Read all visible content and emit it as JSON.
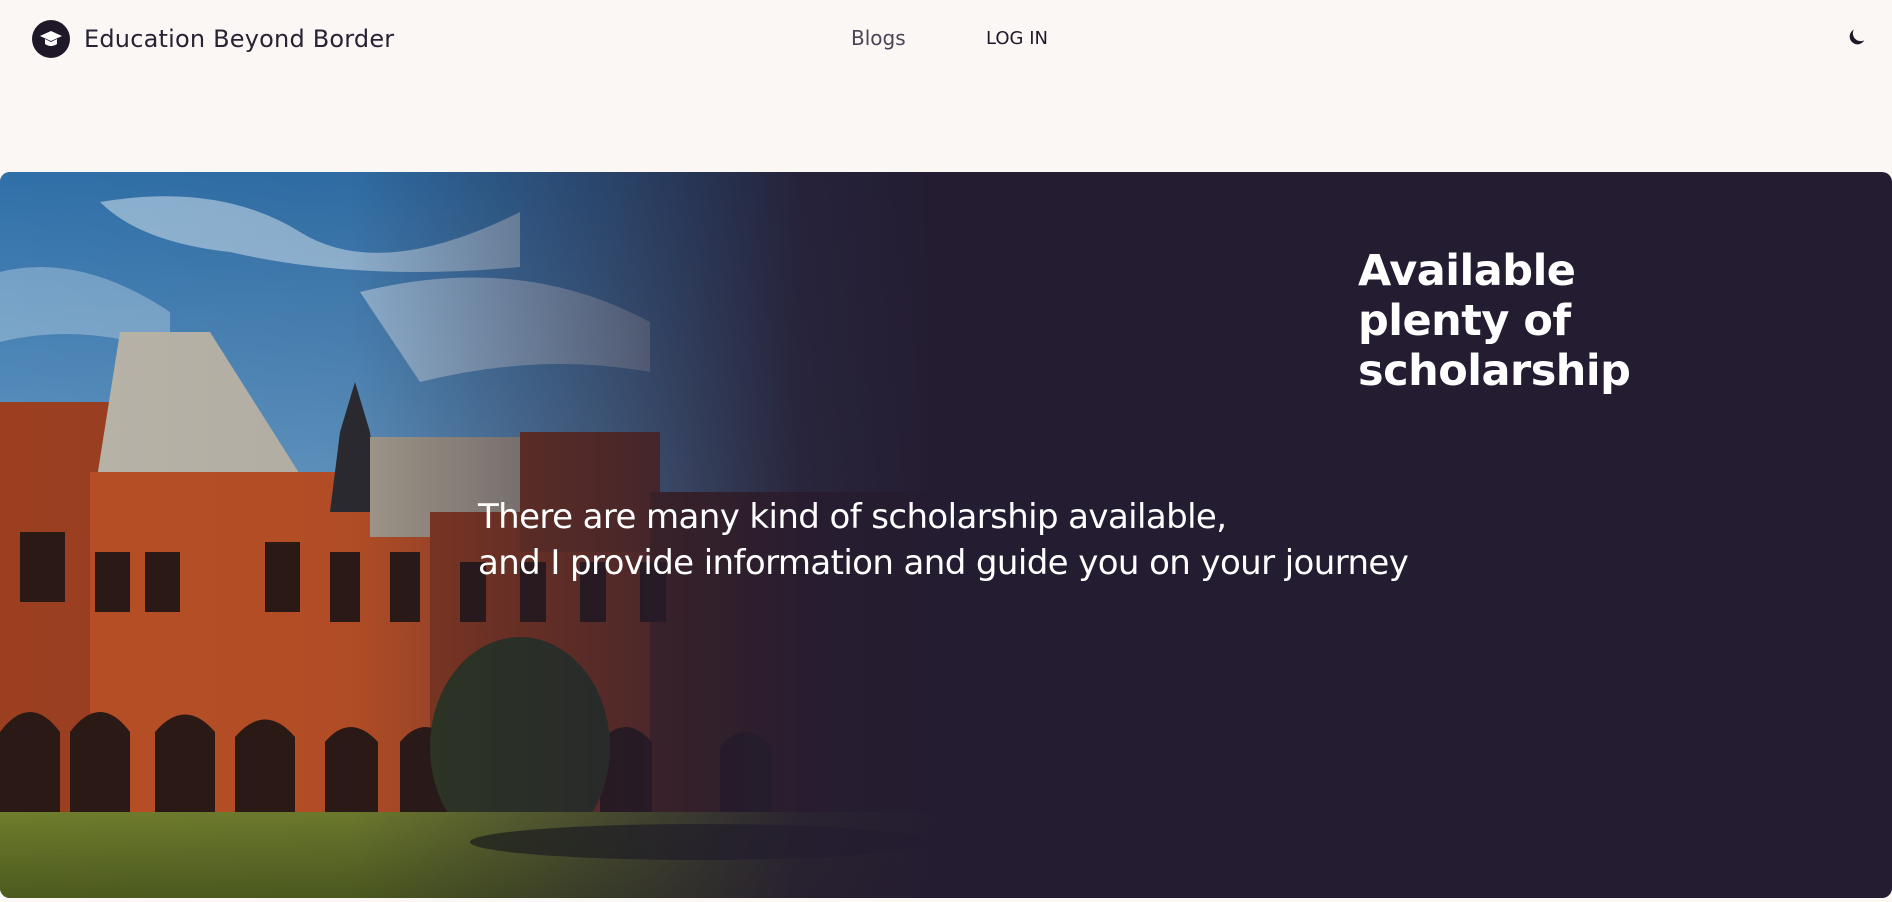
{
  "navbar": {
    "brand": "Education Beyond Border",
    "logo_icon": "graduation-cap-icon",
    "links": [
      {
        "label": "Blogs"
      },
      {
        "label": "LOG IN"
      }
    ],
    "theme_toggle_icon": "moon-icon"
  },
  "hero": {
    "image": "university-building-photo",
    "title": "Available plenty of scholarship",
    "description_lines": [
      "There are many kind of scholarship available,",
      "and I provide information and guide you on your journey"
    ],
    "colors": {
      "background": "#241c31",
      "text": "#ffffff"
    }
  },
  "page": {
    "background": "#faf7f5",
    "text": "#2b2134"
  }
}
